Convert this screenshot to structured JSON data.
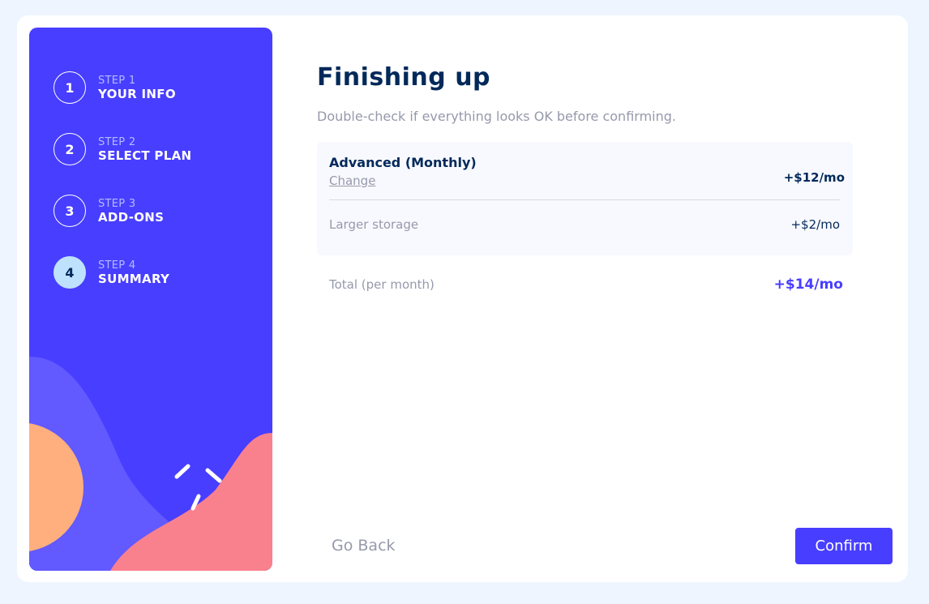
{
  "steps": [
    {
      "num": "1",
      "label": "STEP 1",
      "title": "YOUR INFO",
      "active": false
    },
    {
      "num": "2",
      "label": "STEP 2",
      "title": "SELECT PLAN",
      "active": false
    },
    {
      "num": "3",
      "label": "STEP 3",
      "title": "ADD-ONS",
      "active": false
    },
    {
      "num": "4",
      "label": "STEP 4",
      "title": "SUMMARY",
      "active": true
    }
  ],
  "main": {
    "title": "Finishing up",
    "subtitle": "Double-check if everything looks OK before confirming."
  },
  "summary": {
    "plan_name": "Advanced (Monthly)",
    "change_label": "Change",
    "plan_price": "+$12/mo",
    "addons": [
      {
        "name": "Larger storage",
        "price": "+$2/mo"
      }
    ],
    "total_label": "Total (per month)",
    "total_value": "+$14/mo"
  },
  "buttons": {
    "back": "Go Back",
    "confirm": "Confirm"
  },
  "colors": {
    "accent": "#483eff",
    "dark_text": "#02295a",
    "muted_text": "#9699ab",
    "active_step": "#bee2fd",
    "page_background": "#eff5ff"
  }
}
